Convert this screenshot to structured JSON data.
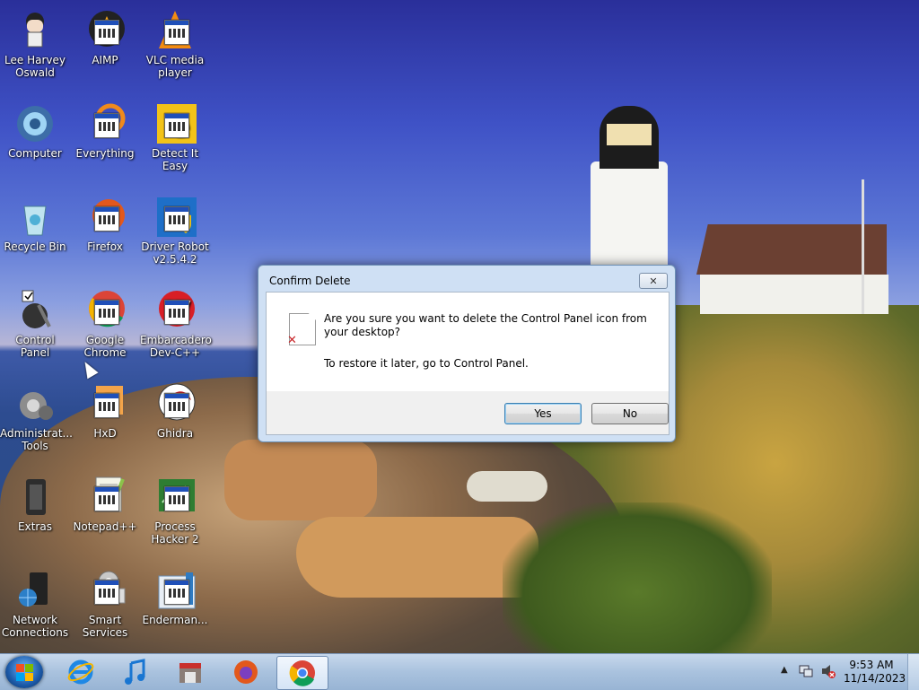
{
  "desktop": {
    "icons": [
      {
        "label": "Lee Harvey Oswald",
        "icon": "anime-avatar-icon"
      },
      {
        "label": "AIMP",
        "icon": "aimp-icon"
      },
      {
        "label": "VLC media player",
        "icon": "vlc-icon"
      },
      {
        "label": "Computer",
        "icon": "computer-icon"
      },
      {
        "label": "Everything",
        "icon": "everything-icon"
      },
      {
        "label": "Detect It Easy",
        "icon": "detect-it-easy-icon"
      },
      {
        "label": "Recycle Bin",
        "icon": "recycle-bin-icon"
      },
      {
        "label": "Firefox",
        "icon": "firefox-icon"
      },
      {
        "label": "Driver Robot v2.5.4.2",
        "icon": "driver-robot-icon"
      },
      {
        "label": "Control Panel",
        "icon": "control-panel-icon"
      },
      {
        "label": "Google Chrome",
        "icon": "chrome-icon"
      },
      {
        "label": "Embarcadero Dev-C++",
        "icon": "devcpp-icon"
      },
      {
        "label": "Administrat... Tools",
        "icon": "admin-tools-icon"
      },
      {
        "label": "HxD",
        "icon": "hxd-icon"
      },
      {
        "label": "Ghidra",
        "icon": "ghidra-icon"
      },
      {
        "label": "Extras",
        "icon": "extras-icon"
      },
      {
        "label": "Notepad++",
        "icon": "notepadpp-icon"
      },
      {
        "label": "Process Hacker 2",
        "icon": "process-hacker-icon"
      },
      {
        "label": "Network Connections",
        "icon": "network-connections-icon"
      },
      {
        "label": "Smart Services",
        "icon": "smart-services-icon"
      },
      {
        "label": "Enderman...",
        "icon": "enderman-icon"
      }
    ]
  },
  "dialog": {
    "title": "Confirm Delete",
    "message": "Are you sure you want to delete the Control Panel icon from your desktop?",
    "note": "To restore it later, go to Control Panel.",
    "yes_label": "Yes",
    "no_label": "No",
    "close_glyph": "✕"
  },
  "taskbar": {
    "pinned": [
      "internet-explorer-icon",
      "itunes-icon",
      "store-icon",
      "firefox-icon",
      "chrome-icon"
    ],
    "active": "chrome-icon",
    "clock_time": "9:53 AM",
    "clock_date": "11/14/2023"
  },
  "colors": {
    "dialog_frame": "#cfe0f4",
    "taskbar": "#a9c2de",
    "accent": "#3c7fb1"
  }
}
